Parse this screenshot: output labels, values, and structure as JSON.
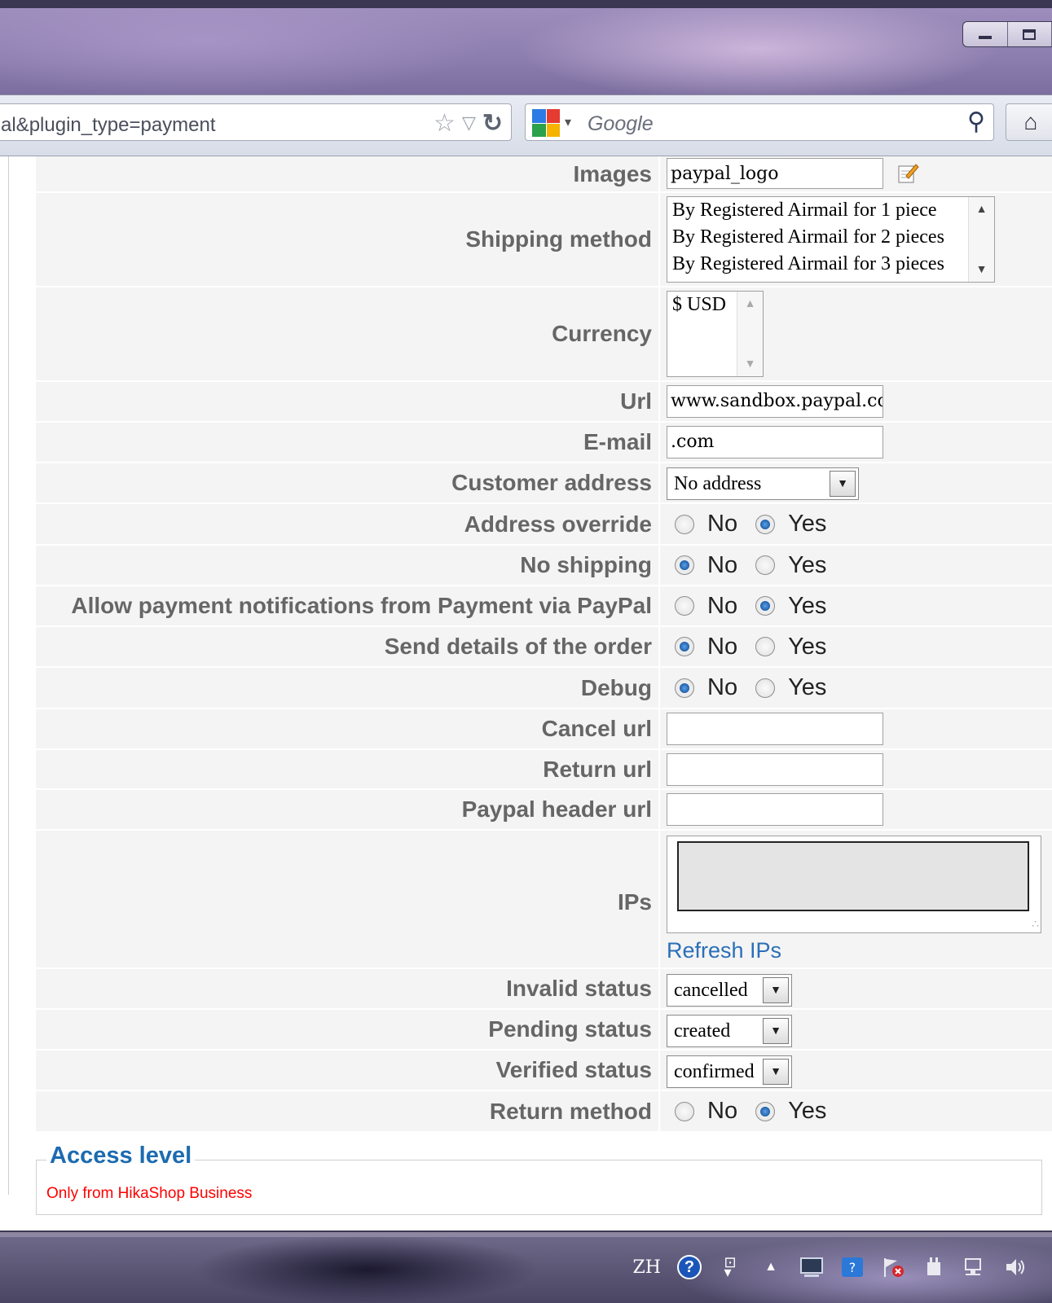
{
  "browser": {
    "url": "al&plugin_type=payment",
    "search_placeholder": "Google"
  },
  "form": {
    "images": {
      "label": "Images",
      "value": "paypal_logo"
    },
    "shipping_method": {
      "label": "Shipping method",
      "options": [
        "By Registered Airmail for 1 piece",
        "By Registered Airmail for 2 pieces",
        "By Registered Airmail for 3 pieces"
      ]
    },
    "currency": {
      "label": "Currency",
      "options": [
        "$ USD"
      ]
    },
    "url": {
      "label": "Url",
      "value": "www.sandbox.paypal.com/"
    },
    "email": {
      "label": "E-mail",
      "value": ".com"
    },
    "customer_address": {
      "label": "Customer address",
      "value": "No address"
    },
    "address_override": {
      "label": "Address override",
      "no": "No",
      "yes": "Yes",
      "selected": "Yes"
    },
    "no_shipping": {
      "label": "No shipping",
      "no": "No",
      "yes": "Yes",
      "selected": "No"
    },
    "allow_notifications": {
      "label": "Allow payment notifications from Payment via PayPal",
      "no": "No",
      "yes": "Yes",
      "selected": "Yes"
    },
    "send_details": {
      "label": "Send details of the order",
      "no": "No",
      "yes": "Yes",
      "selected": "No"
    },
    "debug": {
      "label": "Debug",
      "no": "No",
      "yes": "Yes",
      "selected": "No"
    },
    "cancel_url": {
      "label": "Cancel url",
      "value": ""
    },
    "return_url": {
      "label": "Return url",
      "value": ""
    },
    "paypal_header_url": {
      "label": "Paypal header url",
      "value": ""
    },
    "ips": {
      "label": "IPs",
      "refresh_label": "Refresh IPs"
    },
    "invalid_status": {
      "label": "Invalid status",
      "value": "cancelled"
    },
    "pending_status": {
      "label": "Pending status",
      "value": "created"
    },
    "verified_status": {
      "label": "Verified status",
      "value": "confirmed"
    },
    "return_method": {
      "label": "Return method",
      "no": "No",
      "yes": "Yes",
      "selected": "Yes"
    }
  },
  "access_level": {
    "legend": "Access level",
    "note": "Only from HikaShop Business"
  },
  "taskbar": {
    "language": "ZH"
  }
}
